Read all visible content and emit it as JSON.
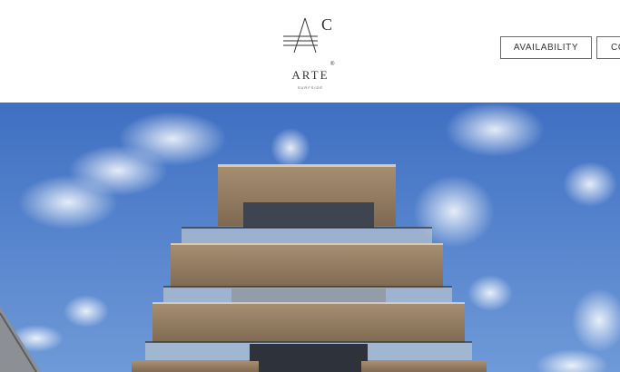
{
  "header": {
    "logo": {
      "letter": "C",
      "wordmark": "ARTE",
      "subtitle": "SURFSIDE",
      "registered": "®"
    },
    "nav": {
      "availability_label": "AVAILABILITY",
      "contact_label": "CO"
    }
  },
  "hero": {
    "image_subject": "building-photo",
    "sky_color": "#4a79c9"
  }
}
